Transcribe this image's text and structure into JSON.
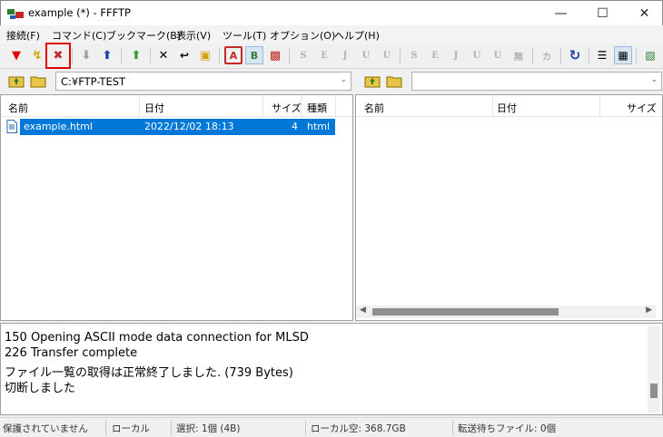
{
  "window": {
    "title": "example (*) - FFFTP"
  },
  "menu": [
    "接続(F)",
    "コマンド(C)",
    "ブックマーク(B)",
    "表示(V)",
    "ツール(T)",
    "オプション(O)",
    "ヘルプ(H)"
  ],
  "toolbar": {
    "text_buttons": [
      "A",
      "B",
      "S",
      "E",
      "J",
      "U",
      "U",
      "S",
      "E",
      "J",
      "U",
      "U",
      "無",
      "カ"
    ]
  },
  "local": {
    "path": "C:¥FTP-TEST",
    "columns": [
      "名前",
      "日付",
      "サイズ",
      "種類"
    ],
    "files": [
      {
        "name": "example.html",
        "date": "2022/12/02 18:13",
        "size": "4",
        "type": "html"
      }
    ]
  },
  "remote": {
    "path": "",
    "columns": [
      "名前",
      "日付",
      "サイズ"
    ]
  },
  "log": [
    "150 Opening ASCII mode data connection for MLSD",
    "226 Transfer complete",
    "ファイル一覧の取得は正常終了しました. (739 Bytes)",
    "切断しました"
  ],
  "status": {
    "protect": "保護されていません",
    "mode": "ローカル",
    "selection": "選択: 1個 (4B)",
    "free": "ローカル空: 368.7GB",
    "queue": "転送待ちファイル: 0個"
  },
  "colors": {
    "selection": "#0078d7",
    "highlight": "#e00000"
  }
}
